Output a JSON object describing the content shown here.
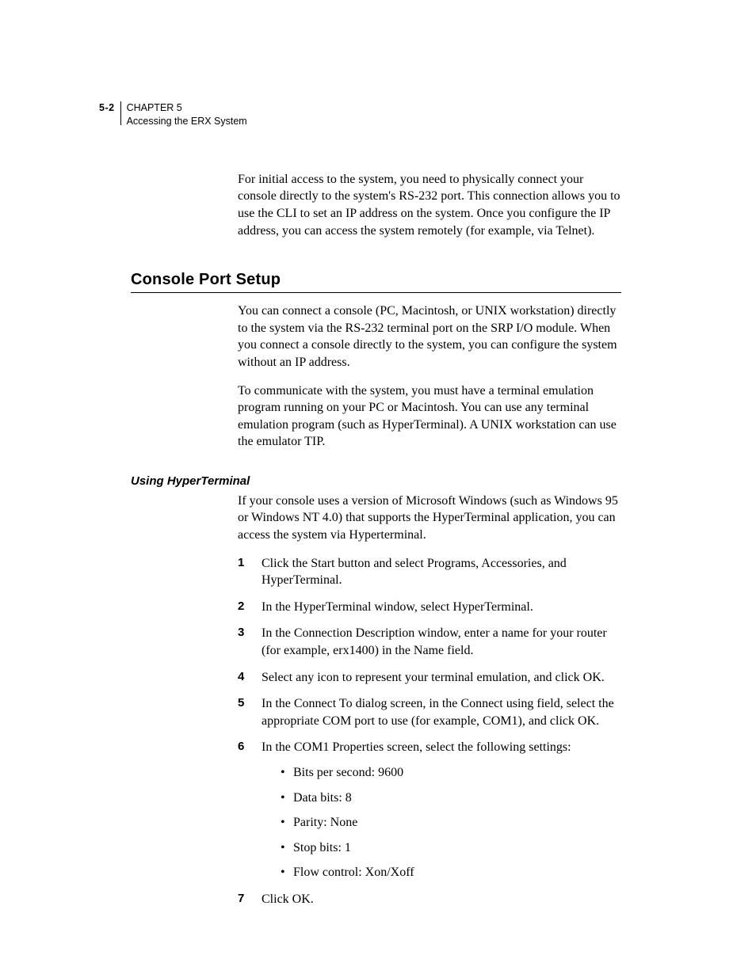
{
  "header": {
    "page_number": "5-2",
    "chapter_line": "CHAPTER 5",
    "chapter_title": "Accessing the ERX System"
  },
  "intro": "For initial access to the system, you need to physically connect your console directly to the system's RS-232 port. This connection allows you to use the CLI to set an IP address on the system. Once you configure the IP address, you can access the system remotely (for example, via Telnet).",
  "section": {
    "title": "Console Port Setup",
    "para1": "You can connect a console (PC, Macintosh, or UNIX workstation) directly to the system via the RS-232 terminal port on the SRP I/O module. When you connect a console directly to the system, you can configure the system without an IP address.",
    "para2": "To communicate with the system, you must have a terminal emulation program running on your PC or Macintosh. You can use any terminal emulation program (such as HyperTerminal). A UNIX workstation can use the emulator TIP."
  },
  "subsection": {
    "title": "Using HyperTerminal",
    "intro": "If your console uses a version of Microsoft Windows (such as Windows 95 or Windows NT 4.0) that supports the HyperTerminal application, you can access the system via Hyperterminal.",
    "steps": [
      "Click the Start button and select Programs, Accessories, and HyperTerminal.",
      "In the HyperTerminal window, select HyperTerminal.",
      "In the Connection Description window, enter a name for your router (for example, erx1400) in the Name field.",
      "Select any icon to represent your terminal emulation, and click OK.",
      "In the Connect To dialog screen, in the Connect using field, select the appropriate COM port to use (for example, COM1), and click OK.",
      "In the COM1 Properties screen, select the following settings:",
      "Click OK."
    ],
    "settings": [
      "Bits per second: 9600",
      "Data bits: 8",
      "Parity: None",
      "Stop bits: 1",
      "Flow control: Xon/Xoff"
    ]
  }
}
